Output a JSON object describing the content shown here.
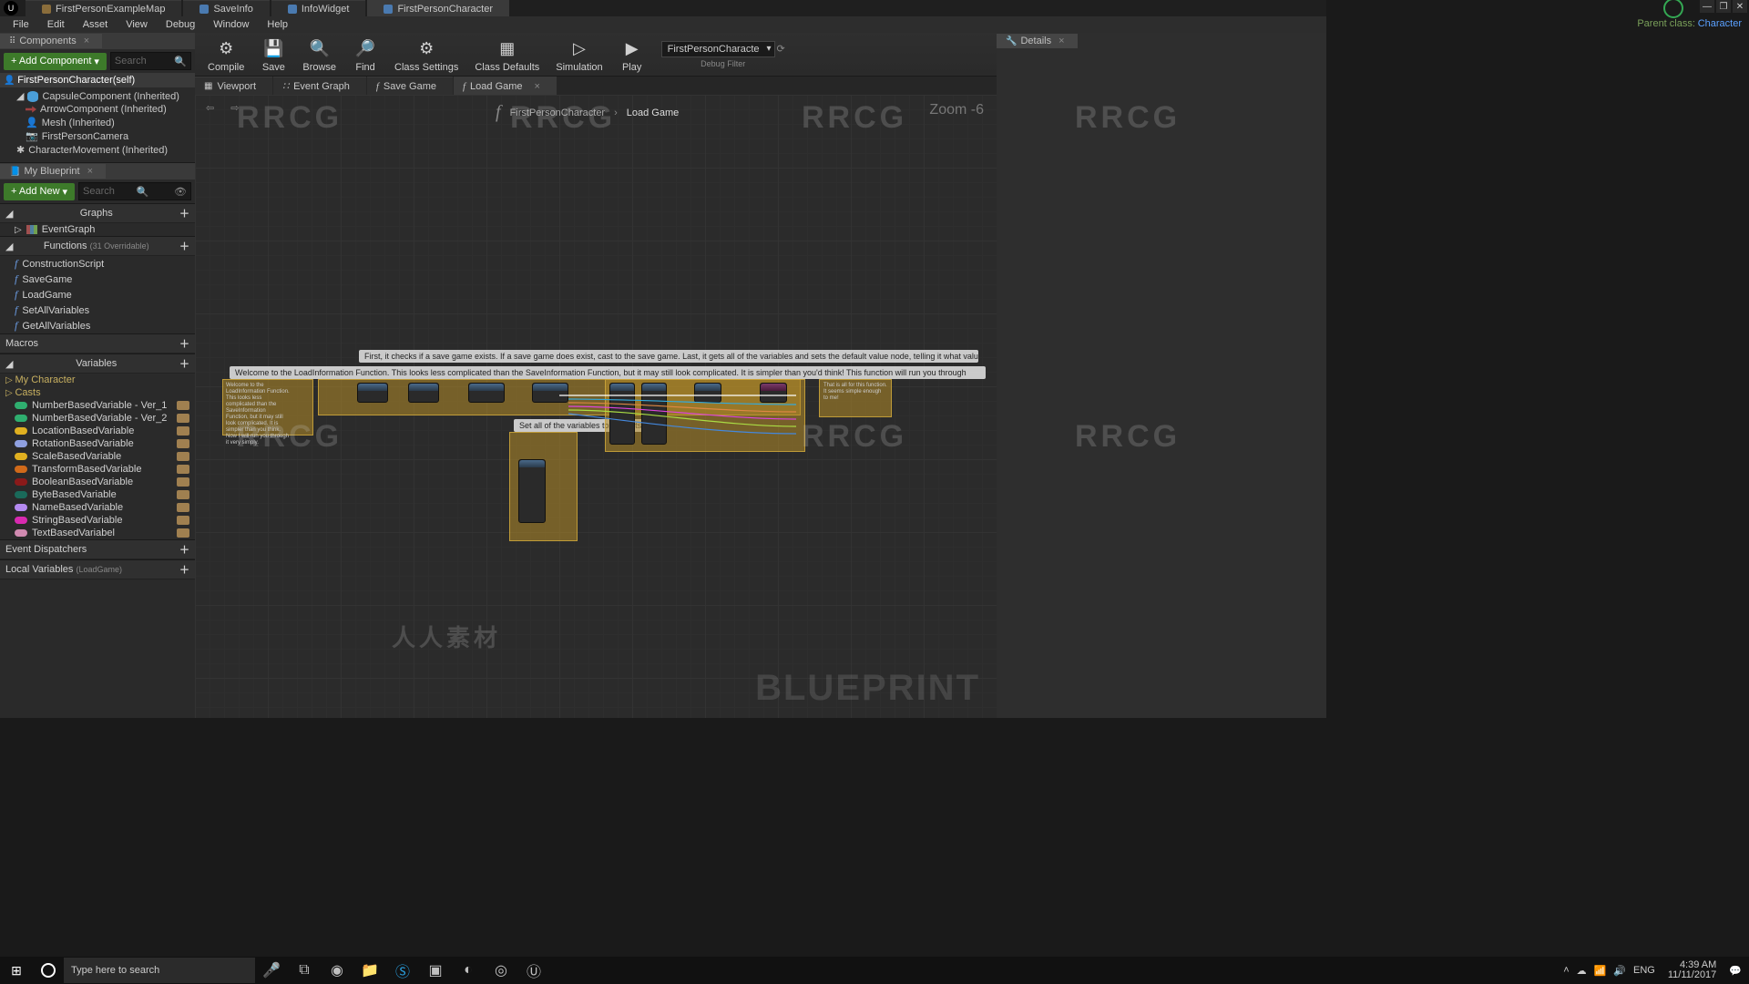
{
  "editorTabs": [
    "FirstPersonExampleMap",
    "SaveInfo",
    "InfoWidget",
    "FirstPersonCharacter"
  ],
  "activeEditorTab": 3,
  "parentClass": {
    "label": "Parent class:",
    "value": "Character"
  },
  "menubar": [
    "File",
    "Edit",
    "Asset",
    "View",
    "Debug",
    "Window",
    "Help"
  ],
  "componentsPanel": {
    "tab": "Components",
    "addBtn": "+ Add Component",
    "searchPlaceholder": "Search",
    "root": "FirstPersonCharacter(self)",
    "tree": [
      {
        "label": "CapsuleComponent (Inherited)",
        "icon": "capsule",
        "indent": 1
      },
      {
        "label": "ArrowComponent (Inherited)",
        "icon": "arrow",
        "indent": 2
      },
      {
        "label": "Mesh (Inherited)",
        "icon": "mesh",
        "indent": 2
      },
      {
        "label": "FirstPersonCamera",
        "icon": "cam",
        "indent": 2
      },
      {
        "label": "CharacterMovement (Inherited)",
        "icon": "move",
        "indent": 1
      }
    ]
  },
  "myBlueprint": {
    "tab": "My Blueprint",
    "addBtn": "+ Add New",
    "searchPlaceholder": "Search",
    "graphs": {
      "hdr": "Graphs",
      "items": [
        "EventGraph"
      ]
    },
    "functions": {
      "hdr": "Functions",
      "override": "(31 Overridable)",
      "items": [
        "ConstructionScript",
        "SaveGame",
        "LoadGame",
        "SetAllVariables",
        "GetAllVariables"
      ]
    },
    "macros": {
      "hdr": "Macros"
    },
    "variables": {
      "hdr": "Variables",
      "groups": [
        {
          "name": "My Character"
        },
        {
          "name": "Casts"
        }
      ],
      "items": [
        {
          "label": "NumberBasedVariable - Ver_1",
          "color": "#2fae6f"
        },
        {
          "label": "NumberBasedVariable - Ver_2",
          "color": "#2fae6f"
        },
        {
          "label": "LocationBasedVariable",
          "color": "#e0b020"
        },
        {
          "label": "RotationBasedVariable",
          "color": "#8fa0e0"
        },
        {
          "label": "ScaleBasedVariable",
          "color": "#e0b020"
        },
        {
          "label": "TransformBasedVariable",
          "color": "#d06a1a"
        },
        {
          "label": "BooleanBasedVariable",
          "color": "#8a1a1a"
        },
        {
          "label": "ByteBasedVariable",
          "color": "#1a6a5a"
        },
        {
          "label": "NameBasedVariable",
          "color": "#b48af0"
        },
        {
          "label": "StringBasedVariable",
          "color": "#d82ab0"
        },
        {
          "label": "TextBasedVariabel",
          "color": "#d08ab0"
        }
      ]
    },
    "dispatchers": {
      "hdr": "Event Dispatchers"
    },
    "locals": {
      "hdr": "Local Variables",
      "scope": "(LoadGame)"
    }
  },
  "toolbar": {
    "buttons": [
      {
        "label": "Compile",
        "icon": "⚙"
      },
      {
        "label": "Save",
        "icon": "💾"
      },
      {
        "label": "Browse",
        "icon": "🔍"
      },
      {
        "label": "Find",
        "icon": "🔎"
      },
      {
        "label": "Class Settings",
        "icon": "⚙"
      },
      {
        "label": "Class Defaults",
        "icon": "▦"
      },
      {
        "label": "Simulation",
        "icon": "▷"
      },
      {
        "label": "Play",
        "icon": "▶"
      }
    ],
    "debugDropdown": "FirstPersonCharacte",
    "debugLabel": "Debug Filter"
  },
  "graphTabs": [
    {
      "label": "Viewport",
      "icon": "▦"
    },
    {
      "label": "Event Graph",
      "icon": "f"
    },
    {
      "label": "Save Game",
      "icon": "f"
    },
    {
      "label": "Load Game",
      "icon": "f",
      "active": true
    }
  ],
  "canvas": {
    "breadcrumb": [
      "FirstPersonCharacter",
      "Load Game"
    ],
    "zoom": "Zoom -6",
    "blueprintWM": "BLUEPRINT",
    "comments": [
      "First, it checks if a save game exists. If a save game does exist, cast to the save game. Last, it gets all of the variables and sets the default value node, telling it what values to load.",
      "Welcome to the LoadInformation Function. This looks less complicated than the SaveInformation Function, but it may still look complicated. It is simpler than you'd think! This function will run you through",
      "Set all of the variables to Defaults."
    ],
    "leftNote": "Welcome to the LoadInformation Function. This looks less complicated than the SaveInformation Function, but it may still look complicated. It is simpler than you think. Now I will run you through it very simply.",
    "rightNote": "That is all for this function. It seems simple enough to me!"
  },
  "detailsPanel": {
    "tab": "Details"
  },
  "taskbar": {
    "searchPlaceholder": "Type here to search",
    "time": "4:39 AM",
    "date": "11/11/2017"
  },
  "watermarkText": "RRCG",
  "centerWM": "人人素材"
}
